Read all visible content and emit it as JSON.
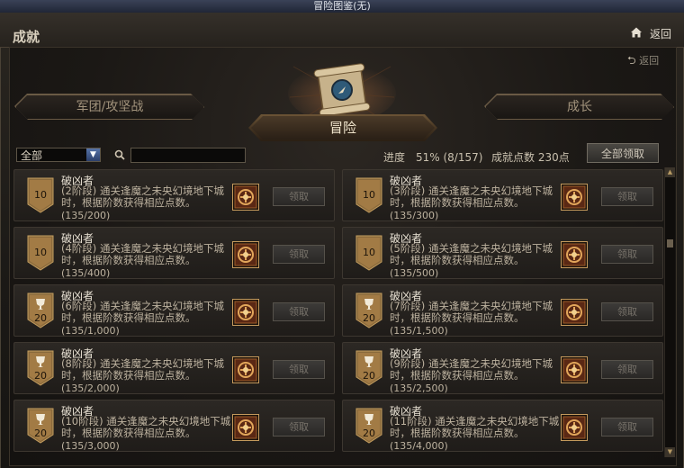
{
  "window": {
    "title": "冒险图鉴(无)"
  },
  "header": {
    "title": "成就",
    "back_label": "返回"
  },
  "inner_back_label": "返回",
  "tabs": {
    "left": "军团/攻坚战",
    "center": "冒险",
    "right": "成长"
  },
  "filter": {
    "selected": "全部",
    "search_value": ""
  },
  "stats": {
    "progress": "进度　51% (8/157)",
    "points": "成就点数 230点"
  },
  "claim_all_label": "全部领取",
  "cards": [
    {
      "title": "破凶者",
      "desc": "(2阶段) 通关逢魔之未央幻境地下城时，根据阶数获得相应点数。",
      "count": "(135/200)",
      "badge": "10",
      "badge_kind": "shield",
      "claim": "领取"
    },
    {
      "title": "破凶者",
      "desc": "(3阶段) 通关逢魔之未央幻境地下城时，根据阶数获得相应点数。",
      "count": "(135/300)",
      "badge": "10",
      "badge_kind": "shield",
      "claim": "领取"
    },
    {
      "title": "破凶者",
      "desc": "(4阶段) 通关逢魔之未央幻境地下城时，根据阶数获得相应点数。",
      "count": "(135/400)",
      "badge": "10",
      "badge_kind": "shield",
      "claim": "领取"
    },
    {
      "title": "破凶者",
      "desc": "(5阶段) 通关逢魔之未央幻境地下城时，根据阶数获得相应点数。",
      "count": "(135/500)",
      "badge": "10",
      "badge_kind": "shield",
      "claim": "领取"
    },
    {
      "title": "破凶者",
      "desc": "(6阶段) 通关逢魔之未央幻境地下城时，根据阶数获得相应点数。",
      "count": "(135/1,000)",
      "badge": "20",
      "badge_kind": "trophy",
      "claim": "领取"
    },
    {
      "title": "破凶者",
      "desc": "(7阶段) 通关逢魔之未央幻境地下城时，根据阶数获得相应点数。",
      "count": "(135/1,500)",
      "badge": "20",
      "badge_kind": "trophy",
      "claim": "领取"
    },
    {
      "title": "破凶者",
      "desc": "(8阶段) 通关逢魔之未央幻境地下城时，根据阶数获得相应点数。",
      "count": "(135/2,000)",
      "badge": "20",
      "badge_kind": "trophy",
      "claim": "领取"
    },
    {
      "title": "破凶者",
      "desc": "(9阶段) 通关逢魔之未央幻境地下城时，根据阶数获得相应点数。",
      "count": "(135/2,500)",
      "badge": "20",
      "badge_kind": "trophy",
      "claim": "领取"
    },
    {
      "title": "破凶者",
      "desc": "(10阶段) 通关逢魔之未央幻境地下城时，根据阶数获得相应点数。",
      "count": "(135/3,000)",
      "badge": "20",
      "badge_kind": "trophy",
      "claim": "领取"
    },
    {
      "title": "破凶者",
      "desc": "(11阶段) 通关逢魔之未央幻境地下城时，根据阶数获得相应点数。",
      "count": "(135/4,000)",
      "badge": "20",
      "badge_kind": "trophy",
      "claim": "领取"
    }
  ]
}
